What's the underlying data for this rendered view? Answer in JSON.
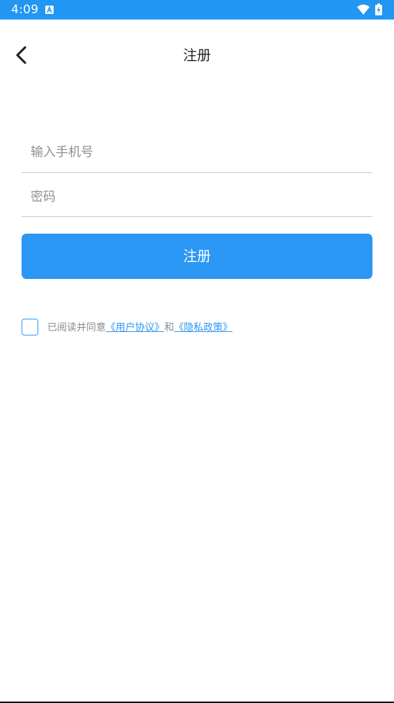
{
  "status_bar": {
    "time": "4:09",
    "notification_icon": "a-icon",
    "wifi_icon": "wifi-icon",
    "battery_icon": "battery-charging-icon",
    "background_color": "#2196f3"
  },
  "toolbar": {
    "back_icon": "chevron-left-icon",
    "title": "注册"
  },
  "form": {
    "phone_placeholder": "输入手机号",
    "phone_value": "",
    "password_placeholder": "密码",
    "password_value": "",
    "submit_label": "注册",
    "accent_color": "#2b97f4"
  },
  "agreement": {
    "checked": false,
    "prefix": "已阅读并同意",
    "user_agreement": "《用户协议》",
    "conjunction": "和",
    "privacy_policy": "《隐私政策》"
  }
}
